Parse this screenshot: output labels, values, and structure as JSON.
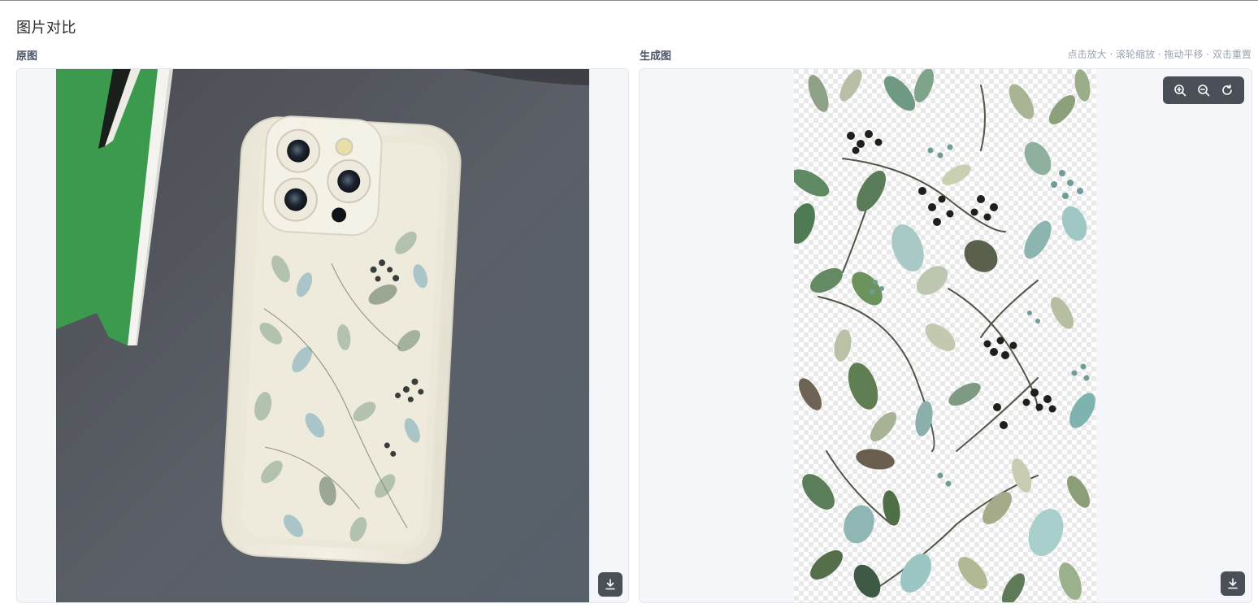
{
  "page": {
    "title": "图片对比"
  },
  "left": {
    "label": "原图"
  },
  "right": {
    "label": "生成图",
    "hint": "点击放大 · 滚轮缩放 · 拖动平移 · 双击重置"
  },
  "icons": {
    "zoom_in": "zoom-in-icon",
    "zoom_out": "zoom-out-icon",
    "reset": "reset-icon",
    "download": "download-icon"
  },
  "colors": {
    "panel_bg": "#f4f6fa",
    "toolbar_bg": "#4a4f57",
    "phone_case": "#f1eee2",
    "table": "#5c6068",
    "book_green": "#3c9a4e"
  }
}
